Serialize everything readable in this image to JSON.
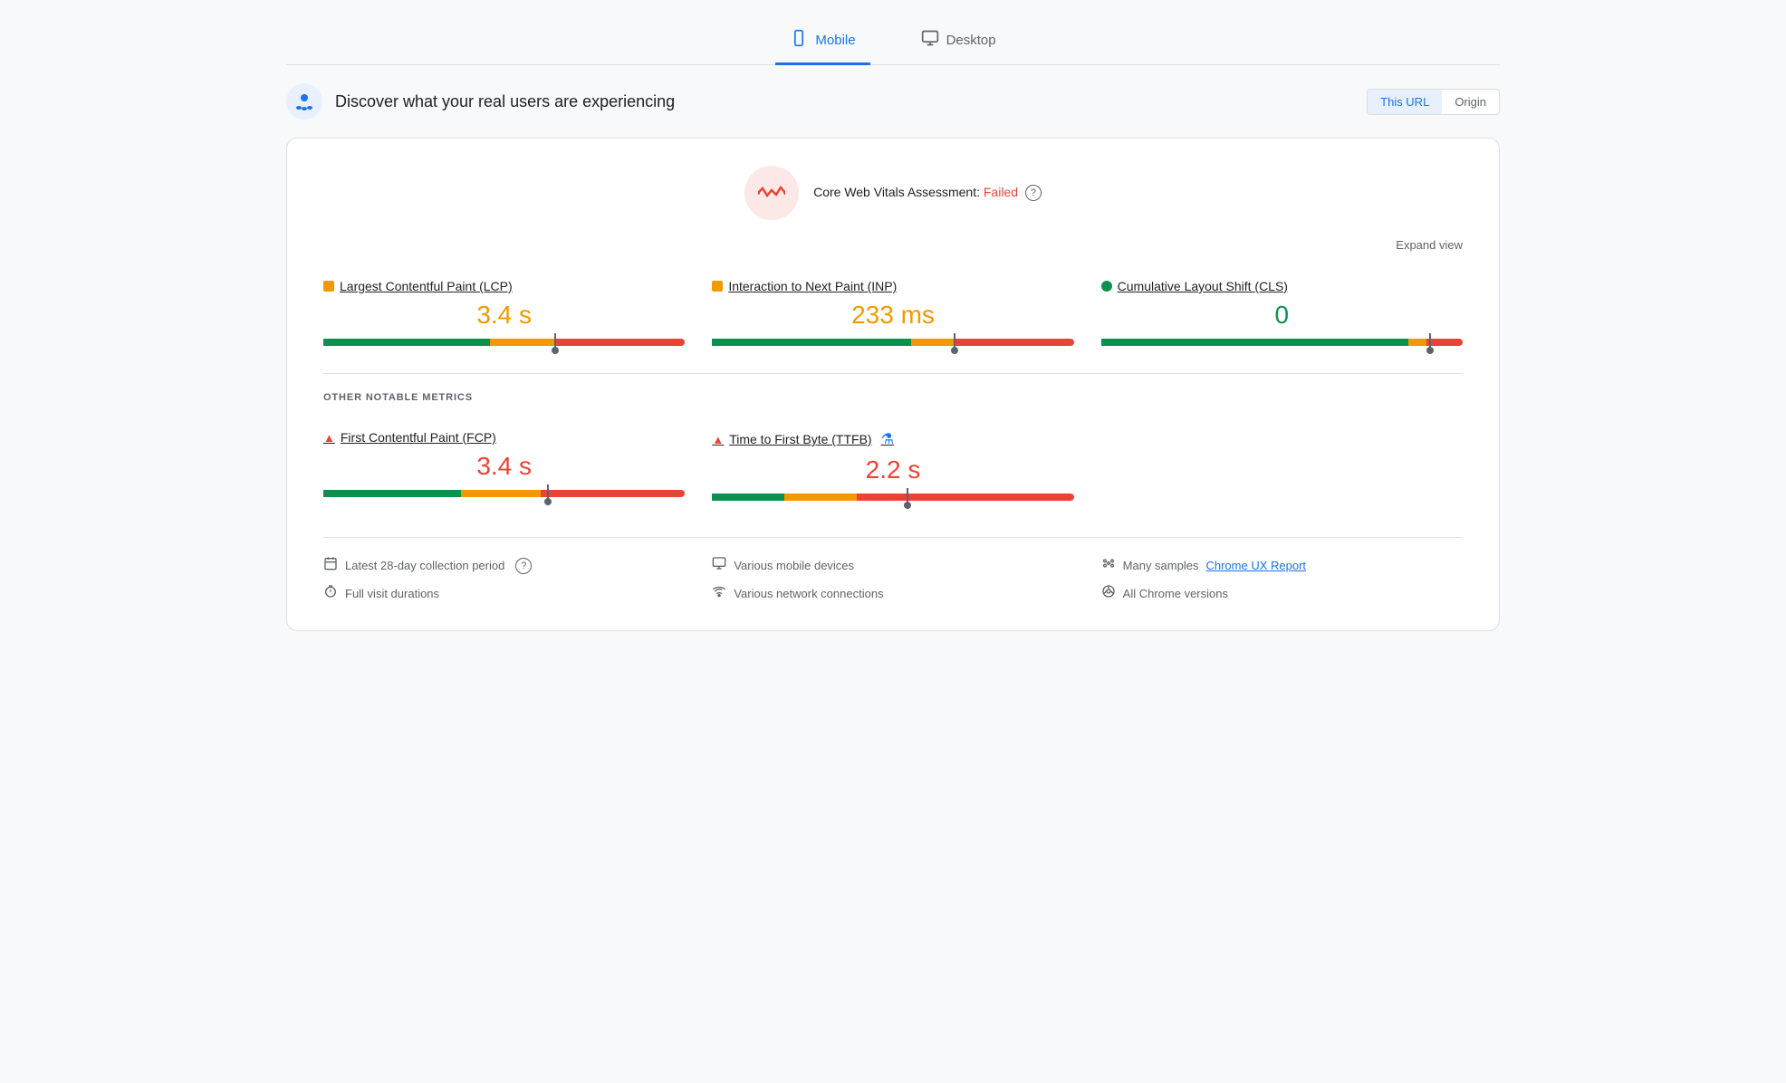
{
  "tabs": [
    {
      "id": "mobile",
      "label": "Mobile",
      "icon": "📱",
      "active": true
    },
    {
      "id": "desktop",
      "label": "Desktop",
      "icon": "🖥",
      "active": false
    }
  ],
  "header": {
    "title": "Discover what your real users are experiencing",
    "url_toggle": {
      "this_url_label": "This URL",
      "origin_label": "Origin",
      "active": "this_url"
    }
  },
  "assessment": {
    "title_prefix": "Core Web Vitals Assessment: ",
    "status": "Failed",
    "help_icon": "?",
    "expand_label": "Expand view"
  },
  "core_metrics": [
    {
      "id": "lcp",
      "label": "Largest Contentful Paint (LCP)",
      "dot_type": "square",
      "dot_color": "orange",
      "value": "3.4 s",
      "value_color": "orange",
      "bar": {
        "green_pct": 46,
        "orange_pct": 18,
        "red_pct": 36,
        "indicator_pct": 64
      }
    },
    {
      "id": "inp",
      "label": "Interaction to Next Paint (INP)",
      "dot_type": "square",
      "dot_color": "orange",
      "value": "233 ms",
      "value_color": "orange",
      "bar": {
        "green_pct": 55,
        "orange_pct": 12,
        "red_pct": 33,
        "indicator_pct": 67
      }
    },
    {
      "id": "cls",
      "label": "Cumulative Layout Shift (CLS)",
      "dot_type": "round",
      "dot_color": "green",
      "value": "0",
      "value_color": "green",
      "bar": {
        "green_pct": 85,
        "orange_pct": 5,
        "red_pct": 10,
        "indicator_pct": 91
      }
    }
  ],
  "other_metrics_label": "OTHER NOTABLE METRICS",
  "other_metrics": [
    {
      "id": "fcp",
      "label": "First Contentful Paint (FCP)",
      "icon": "triangle",
      "value": "3.4 s",
      "value_color": "red",
      "bar": {
        "green_pct": 38,
        "orange_pct": 22,
        "red_pct": 40,
        "indicator_pct": 62
      }
    },
    {
      "id": "ttfb",
      "label": "Time to First Byte (TTFB)",
      "icon": "triangle",
      "extra_icon": "beaker",
      "value": "2.2 s",
      "value_color": "red",
      "bar": {
        "green_pct": 20,
        "orange_pct": 20,
        "red_pct": 60,
        "indicator_pct": 54
      }
    }
  ],
  "footer": {
    "items": [
      {
        "icon": "📅",
        "text": "Latest 28-day collection period",
        "has_help": true
      },
      {
        "icon": "🖥",
        "text": "Various mobile devices"
      },
      {
        "icon": "⚙",
        "text": "Many samples ",
        "link_text": "Chrome UX Report",
        "link": true
      }
    ],
    "items2": [
      {
        "icon": "⏱",
        "text": "Full visit durations"
      },
      {
        "icon": "📶",
        "text": "Various network connections"
      },
      {
        "icon": "🔒",
        "text": "All Chrome versions"
      }
    ]
  },
  "colors": {
    "orange": "#f29900",
    "green": "#0d904f",
    "red": "#ea4335",
    "blue": "#1a73e8"
  }
}
